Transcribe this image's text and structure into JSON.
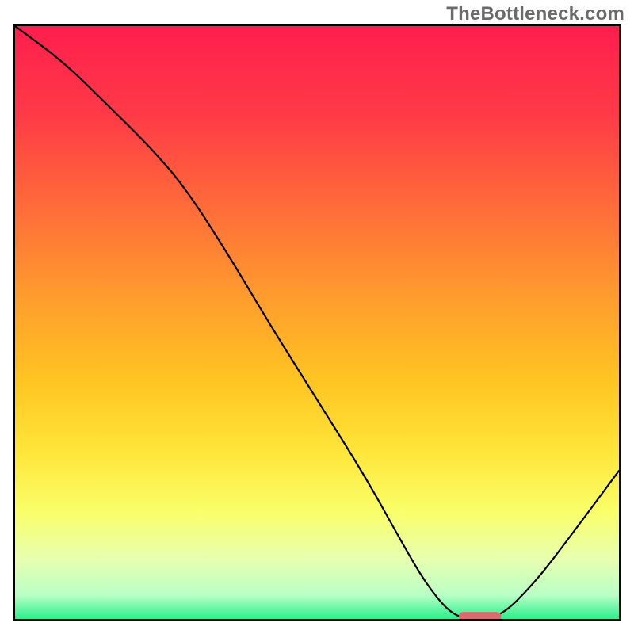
{
  "watermark": "TheBottleneck.com",
  "chart_data": {
    "type": "line",
    "title": "",
    "xlabel": "",
    "ylabel": "",
    "xlim": [
      0,
      100
    ],
    "ylim": [
      0,
      100
    ],
    "series": [
      {
        "name": "curve",
        "x": [
          0,
          8,
          15,
          22,
          28,
          35,
          42,
          50,
          58,
          64,
          68,
          72,
          75,
          80,
          86,
          92,
          100
        ],
        "y": [
          100,
          94,
          87,
          80,
          73,
          62,
          50,
          37,
          24,
          13,
          6,
          1,
          0,
          0,
          6,
          14,
          25
        ]
      }
    ],
    "marker": {
      "x_center": 77,
      "y": 0.5,
      "width": 7,
      "color": "#d96a6d"
    },
    "gradient_stops": [
      {
        "offset": 0.0,
        "color": "#ff1e4d"
      },
      {
        "offset": 0.15,
        "color": "#ff3a47"
      },
      {
        "offset": 0.3,
        "color": "#ff6a3a"
      },
      {
        "offset": 0.45,
        "color": "#ff9a2e"
      },
      {
        "offset": 0.6,
        "color": "#ffc522"
      },
      {
        "offset": 0.72,
        "color": "#ffe63a"
      },
      {
        "offset": 0.82,
        "color": "#f9ff6a"
      },
      {
        "offset": 0.9,
        "color": "#e7ffb0"
      },
      {
        "offset": 0.96,
        "color": "#b9ffc6"
      },
      {
        "offset": 1.0,
        "color": "#29f08a"
      }
    ]
  }
}
